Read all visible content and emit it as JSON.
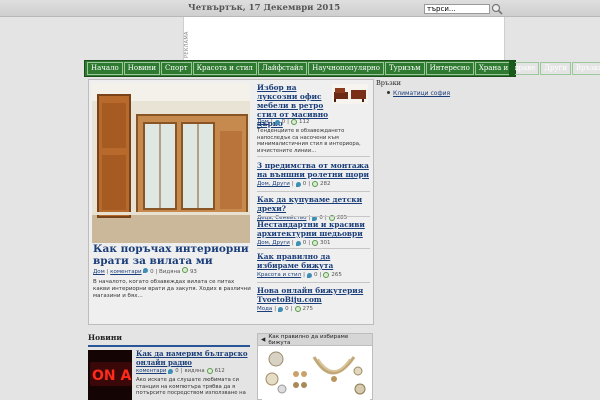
{
  "header": {
    "date": "Четвъртък, 17 Декември 2015",
    "search_value": "търси...",
    "ad_label": "РЕКЛАМА"
  },
  "nav": {
    "items": [
      "Начало",
      "Новини",
      "Спорт",
      "Красота и стил",
      "Лайфстайл",
      "Научнопопулярно",
      "Туризъм",
      "Интересно",
      "Храна и здраве",
      "Други",
      "Връзка с нас"
    ]
  },
  "featured": {
    "title": "Как поръчах интериорни врати за вилата ми",
    "category": "Дом",
    "comments_label": "коментари",
    "comments": "0",
    "views_label": "Видяна",
    "views": "93",
    "excerpt": "В началото, когато обзавеждах вилата се питах какви интериорни врати да закупя. Ходих в различни магазини и бях..."
  },
  "posts": [
    {
      "title": "Избор на луксозни офис мебели в ретро стил от масивно дърво",
      "categories": "Дом",
      "comments": "0",
      "views": "112",
      "excerpt": "Тенденциите в обзавеждането напоследък са насочени към минималистичния стил в интериора, изчистените линии..."
    },
    {
      "title": "3 предимства от монтажа на външни ролетни щори",
      "categories": "Дом, Други",
      "comments": "0",
      "views": "282"
    },
    {
      "title": "Как да купуваме детски дрехи?",
      "categories": "Деца, Семейство",
      "comments": "0",
      "views": "285"
    },
    {
      "title": "Нестандартни и красиви архитектурни шедьоври",
      "categories": "Дом, Други",
      "comments": "0",
      "views": "301"
    },
    {
      "title": "Как правилно да избираме бижута",
      "categories": "Красота и стил",
      "comments": "0",
      "views": "265"
    },
    {
      "title": "Нова онлайн бижутерия TvoetoBiju.com",
      "categories": "Мода",
      "comments": "0",
      "views": "275"
    }
  ],
  "sidebar": {
    "heading": "Връзки",
    "link": "Климатици софия"
  },
  "news": {
    "heading": "Новини",
    "title": "Как да намерим българско онлайн радио",
    "comments_label": "коментари",
    "comments": "0",
    "views_label": "видяна",
    "views": "612",
    "excerpt": "Ако искате да слушате любимата си станция на компютъра трябва да я потърсите посредством използване на"
  },
  "widget": {
    "title": "Как правилно да избираме бижута"
  },
  "colors": {
    "nav_bg": "#2f7a31",
    "link": "#1a3e7a",
    "news_rule": "#2a5597"
  }
}
